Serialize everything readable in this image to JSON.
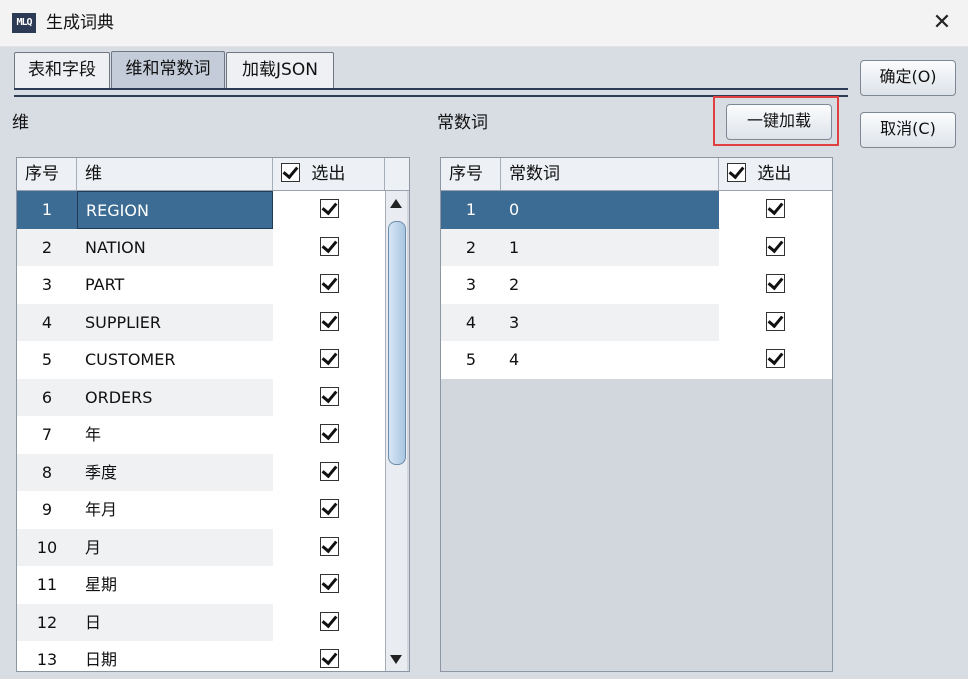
{
  "window": {
    "logo": "MLQ",
    "title": "生成词典",
    "close": "✕"
  },
  "tabs": [
    {
      "label": "表和字段"
    },
    {
      "label": "维和常数词"
    },
    {
      "label": "加载JSON"
    }
  ],
  "buttons": {
    "ok": "确定(O)",
    "cancel": "取消(C)",
    "load_all": "一键加载"
  },
  "dim_section": {
    "label": "维",
    "columns": {
      "index": "序号",
      "name": "维",
      "select": "选出"
    },
    "rows": [
      {
        "index": "1",
        "name": "REGION",
        "checked": true
      },
      {
        "index": "2",
        "name": "NATION",
        "checked": true
      },
      {
        "index": "3",
        "name": "PART",
        "checked": true
      },
      {
        "index": "4",
        "name": "SUPPLIER",
        "checked": true
      },
      {
        "index": "5",
        "name": "CUSTOMER",
        "checked": true
      },
      {
        "index": "6",
        "name": "ORDERS",
        "checked": true
      },
      {
        "index": "7",
        "name": "年",
        "checked": true
      },
      {
        "index": "8",
        "name": "季度",
        "checked": true
      },
      {
        "index": "9",
        "name": "年月",
        "checked": true
      },
      {
        "index": "10",
        "name": "月",
        "checked": true
      },
      {
        "index": "11",
        "name": "星期",
        "checked": true
      },
      {
        "index": "12",
        "name": "日",
        "checked": true
      },
      {
        "index": "13",
        "name": "日期",
        "checked": true
      }
    ]
  },
  "const_section": {
    "label": "常数词",
    "columns": {
      "index": "序号",
      "name": "常数词",
      "select": "选出"
    },
    "rows": [
      {
        "index": "1",
        "name": "0",
        "checked": true
      },
      {
        "index": "2",
        "name": "1",
        "checked": true
      },
      {
        "index": "3",
        "name": "2",
        "checked": true
      },
      {
        "index": "4",
        "name": "3",
        "checked": true
      },
      {
        "index": "5",
        "name": "4",
        "checked": true
      }
    ]
  },
  "colors": {
    "selected_row": "#3c6b94",
    "highlight_frame": "#e04040",
    "header_accent": "#2e3c58"
  }
}
